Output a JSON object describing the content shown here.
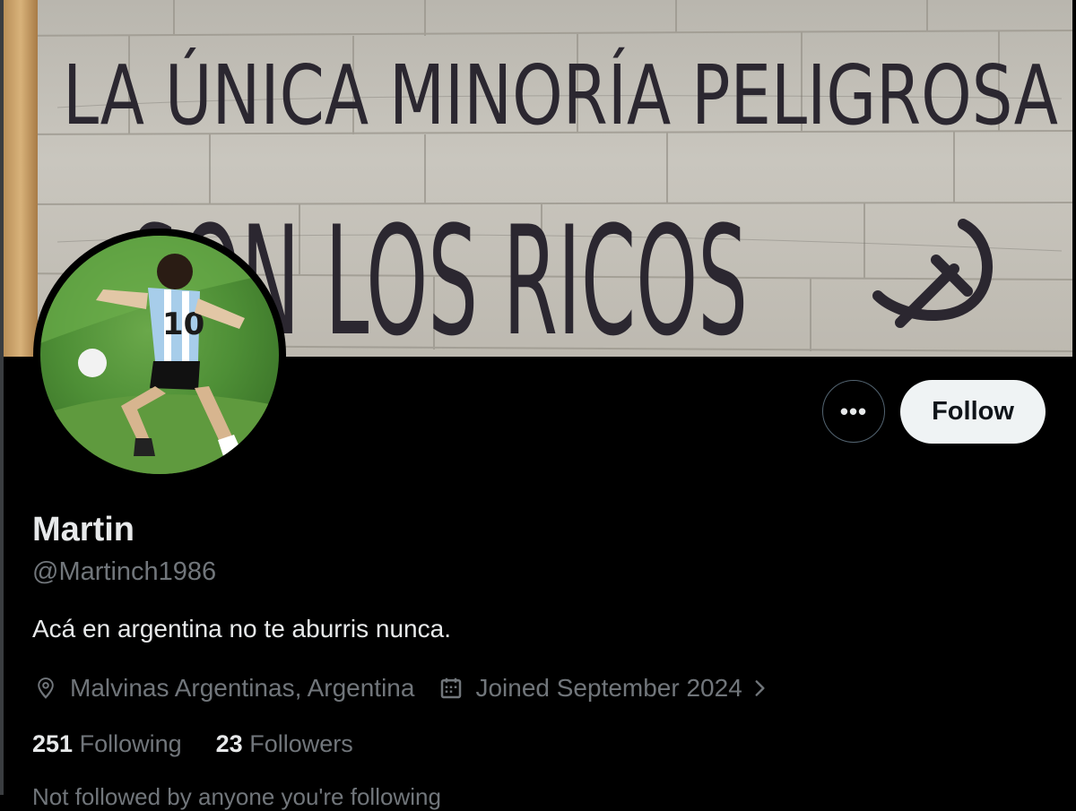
{
  "banner": {
    "line1": "LA ÚNICA MINORÍA PELIGROSA",
    "line2": "SON LOS RICOS"
  },
  "profile": {
    "name": "Martin",
    "handle": "@Martinch1986",
    "bio": "Acá en argentina no te aburris nunca.",
    "location": "Malvinas Argentinas, Argentina",
    "joined": "Joined September 2024",
    "avatar_number": "10"
  },
  "actions": {
    "more_label": "•••",
    "follow_label": "Follow"
  },
  "stats": {
    "following_count": "251",
    "following_label": "Following",
    "followers_count": "23",
    "followers_label": "Followers"
  },
  "footer": {
    "followed_by": "Not followed by anyone you're following"
  },
  "colors": {
    "background": "#000000",
    "text_primary": "#e7e9ea",
    "text_secondary": "#71767b",
    "follow_button_bg": "#eff3f4",
    "follow_button_text": "#0f1419",
    "border": "#536471"
  },
  "icons": [
    "location-pin-icon",
    "calendar-icon",
    "chevron-right-icon",
    "more-horizontal-icon"
  ]
}
